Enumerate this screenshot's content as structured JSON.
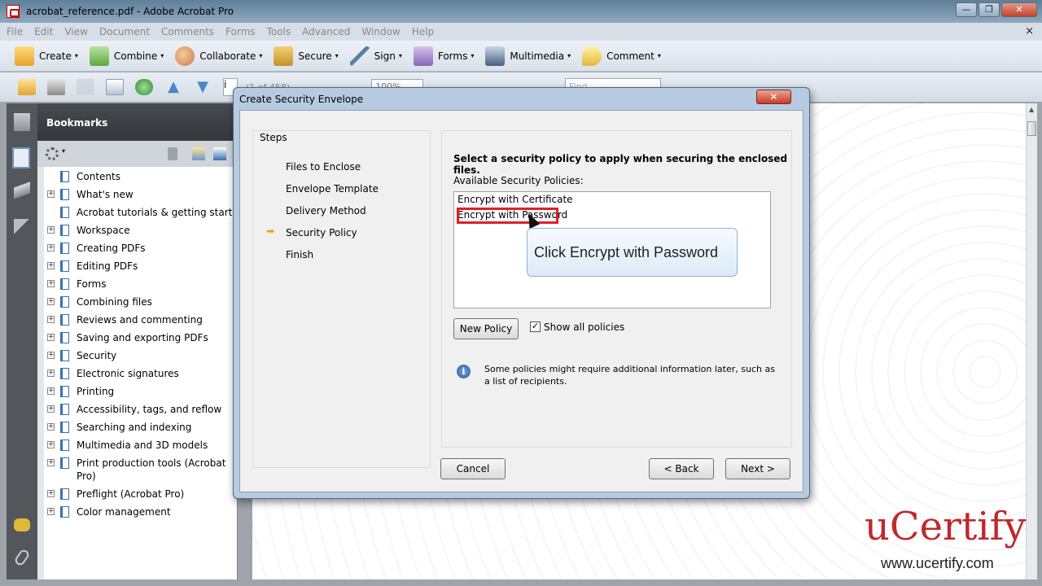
{
  "window": {
    "title": "acrobat_reference.pdf - Adobe Acrobat Pro",
    "minimize": "—",
    "maximize": "❐",
    "close": "✕"
  },
  "menu": [
    "File",
    "Edit",
    "View",
    "Document",
    "Comments",
    "Forms",
    "Tools",
    "Advanced",
    "Window",
    "Help"
  ],
  "menu_close": "×",
  "toolbar": {
    "create": "Create",
    "combine": "Combine",
    "collaborate": "Collaborate",
    "secure": "Secure",
    "sign": "Sign",
    "forms": "Forms",
    "multimedia": "Multimedia",
    "comment": "Comment",
    "arrow": "▾"
  },
  "nav": {
    "page_value": "i",
    "page_count": "(1 of 458)",
    "zoom": "100%",
    "find_placeholder": "Find"
  },
  "bookmarks": {
    "header": "Bookmarks",
    "items": [
      {
        "label": "Contents",
        "expandable": false
      },
      {
        "label": "What's new",
        "expandable": true
      },
      {
        "label": "Acrobat tutorials & getting started",
        "expandable": false
      },
      {
        "label": "Workspace",
        "expandable": true
      },
      {
        "label": "Creating PDFs",
        "expandable": true
      },
      {
        "label": "Editing PDFs",
        "expandable": true
      },
      {
        "label": "Forms",
        "expandable": true
      },
      {
        "label": "Combining files",
        "expandable": true
      },
      {
        "label": "Reviews and commenting",
        "expandable": true
      },
      {
        "label": "Saving and exporting PDFs",
        "expandable": true
      },
      {
        "label": "Security",
        "expandable": true
      },
      {
        "label": "Electronic signatures",
        "expandable": true
      },
      {
        "label": "Printing",
        "expandable": true
      },
      {
        "label": "Accessibility, tags, and reflow",
        "expandable": true
      },
      {
        "label": "Searching and indexing",
        "expandable": true
      },
      {
        "label": "Multimedia and 3D models",
        "expandable": true
      },
      {
        "label": "Print production tools (Acrobat Pro)",
        "expandable": true
      },
      {
        "label": "Preflight (Acrobat Pro)",
        "expandable": true
      },
      {
        "label": "Color management",
        "expandable": true
      }
    ]
  },
  "dialog": {
    "title": "Create Security Envelope",
    "close": "✕",
    "steps_title": "Steps",
    "steps": [
      "Files to Enclose",
      "Envelope Template",
      "Delivery Method",
      "Security Policy",
      "Finish"
    ],
    "current_step": 3,
    "instruction": "Select a security policy to apply when securing the enclosed files.",
    "available_label": "Available Security Policies:",
    "policies": [
      "Encrypt with Certificate",
      "Encrypt with Password"
    ],
    "selected_policy": 1,
    "callout": "Click Encrypt with Password",
    "new_policy": "New Policy",
    "show_all_label": "Show all policies",
    "show_all_checked": true,
    "info_text": "Some policies might require additional information later, such as a list of recipients.",
    "cancel": "Cancel",
    "back": "< Back",
    "next": "Next >"
  },
  "watermark": {
    "logo": "uCertify",
    "url": "www.ucertify.com"
  },
  "colors": {
    "title_bar": "#5d7f98",
    "highlight_box": "#e02028",
    "watermark_red": "#c0282d",
    "step_arrow": "#e6a800"
  }
}
